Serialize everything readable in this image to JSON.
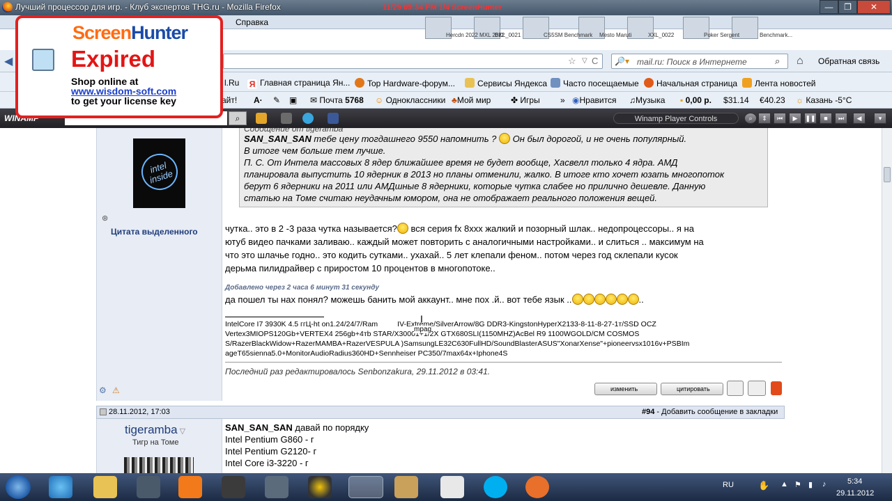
{
  "window": {
    "title": "Лучший процессор для игр. - Клуб экспертов THG.ru - Mozilla Firefox",
    "screenhunter_tag": "11/29  05:34  PM  1/4  ScreenHunter",
    "buttons": [
      "—",
      "❐",
      "✕"
    ]
  },
  "menu": {
    "help": "Справка"
  },
  "thumbnails": [
    "Hercdn 2022 MXL 2022",
    "BKL_0021",
    "CS5SM Benchmark",
    "Mesto Maruti",
    "XXL_0022",
    "Poker Sergent",
    "Benchmark..."
  ],
  "search": {
    "placeholder": "mail.ru: Поиск в Интернете",
    "feedback": "Обратная связь"
  },
  "bookmarks": [
    {
      "label": "l.Ru",
      "color": "#e8a53a"
    },
    {
      "label": "Главная страница Ян...",
      "color": "#e42a1f"
    },
    {
      "label": "Top Hardware-форум...",
      "color": "#e2771a"
    },
    {
      "label": "Сервисы Яндекса",
      "color": "#e9c255"
    },
    {
      "label": "Часто посещаемые",
      "color": "#7090c0"
    },
    {
      "label": "Начальная страница",
      "color": "#e05a1a"
    },
    {
      "label": "Лента новостей",
      "color": "#f0a020"
    }
  ],
  "toolbar2": {
    "left": "айт!",
    "mail": "Почта",
    "mail_count": "5768",
    "ok": "Одноклассники",
    "myworld": "Мой мир",
    "games": "Игры",
    "like": "Нравится",
    "music": "Музыка",
    "money": "0,00 р.",
    "usd": "31.14",
    "eur": "40.23",
    "weather": "Казань -5°C"
  },
  "winamp": {
    "logo": "WINAMP",
    "controls_label": "Winamp Player Controls"
  },
  "screenhunter": {
    "brand_a": "Screen",
    "brand_b": "Hunter",
    "expired": "Expired",
    "shop1": "Shop online at",
    "link": "www.wisdom-soft.com",
    "shop2": "to get your license key"
  },
  "post1": {
    "avatar_text": "intel inside",
    "quote_selected": "Цитата выделенного",
    "quote_header": "Сообщение от tigeramba",
    "quote_author": "SAN_SAN_SAN",
    "quote_line1": " тебе цену тогдашнего 9550 напомнить ? ",
    "quote_line1b": " Он был дорогой, и не очень популярный.",
    "quote_line2": "В итоге чем больше тем лучше.",
    "quote_line3": "П. С. От Интела массовых 8 ядер ближайшее время не будет вообще, Хасвелл только 4 ядра. АМД",
    "quote_line4": "планировала выпустить 10 ядерник в 2013 но планы отменили, жалко. В итоге кто хочет юзать многопоток",
    "quote_line5": "берут 6 ядерники на 2011 или АМДшные 8 ядерники, которые чутка слабее но прилично дешевле. Данную",
    "quote_line6": "статью на Томе считаю неудачным юмором, она не отображает реального положения вещей.",
    "body1a": "чутка.. это в 2 -3 раза чутка называется?",
    "body1b": " вся серия fx 8xxx жалкий и позорный шлак.. недопроцессоры.. я на",
    "body2": "ютуб видео пачками заливаю.. каждый может повторить с аналогичными настройками.. и слиться .. максимум на",
    "body3": "что это шлачье годно.. это кодить сутками.. ухахай.. 5 лет клепали феном.. потом через год склепали кусок",
    "body4": "дерьма пилидрайвер с приростом 10 процентов в многопотоке..",
    "added": "Добавлено через 2 часа 6 минут 31 секунду",
    "body5": "да пошел ты нах понял? можешь банить мой аккаунт.. мне пох .й.. вот тебе язык ..",
    "body5end": "..",
    "sig1": "IntelCore I7 3930K 4.5 ггЦ-ht on1.24/24/7/Ram",
    "sig1b": "IV-Extreme/SilverArrow/8G DDR3-KingstonHyperX2133-8-11-8-27-1т/SSD OCZ",
    "sig_tooltip": "mpag",
    "sig2": "Vertex3MIOPS120Gb+VERTEX4 256gb+4тb STAR/X30001+1/2X GTX680SLI(1150MHZ)AcBel R9 1100WGOLD/CM COSMOS",
    "sig3": "S/RazerBlackWidow+RazerMAMBA+RazerVESPULA )SamsungLE32C630FullHD/SoundBlasterASUS\"XonarXense\"+pioneervsx1016v+PSBIm",
    "sig4": "ageT65sienna5.0+MonitorAudioRadius360HD+Sennheiser PC350/7max64x+Iphone4S",
    "edited": "Последний раз редактировалось Senbonzakura, 29.11.2012 в 03:41.",
    "btn_edit": "изменить",
    "btn_quote": "цитировать"
  },
  "post2": {
    "date": "28.11.2012, 17:03",
    "number": "#94",
    "bookmark": " - Добавить сообщение в закладки",
    "user": "tigeramba",
    "rank": "Тигр на Томе",
    "author": "SAN_SAN_SAN",
    "line1": " давай по порядку",
    "line2": "Intel Pentium G860 - г",
    "line3": "Intel Pentium G2120- г",
    "line4": "Intel Core i3-3220 - г"
  },
  "taskbar": {
    "lang": "RU",
    "time": "5:34",
    "date": "29.11.2012"
  }
}
